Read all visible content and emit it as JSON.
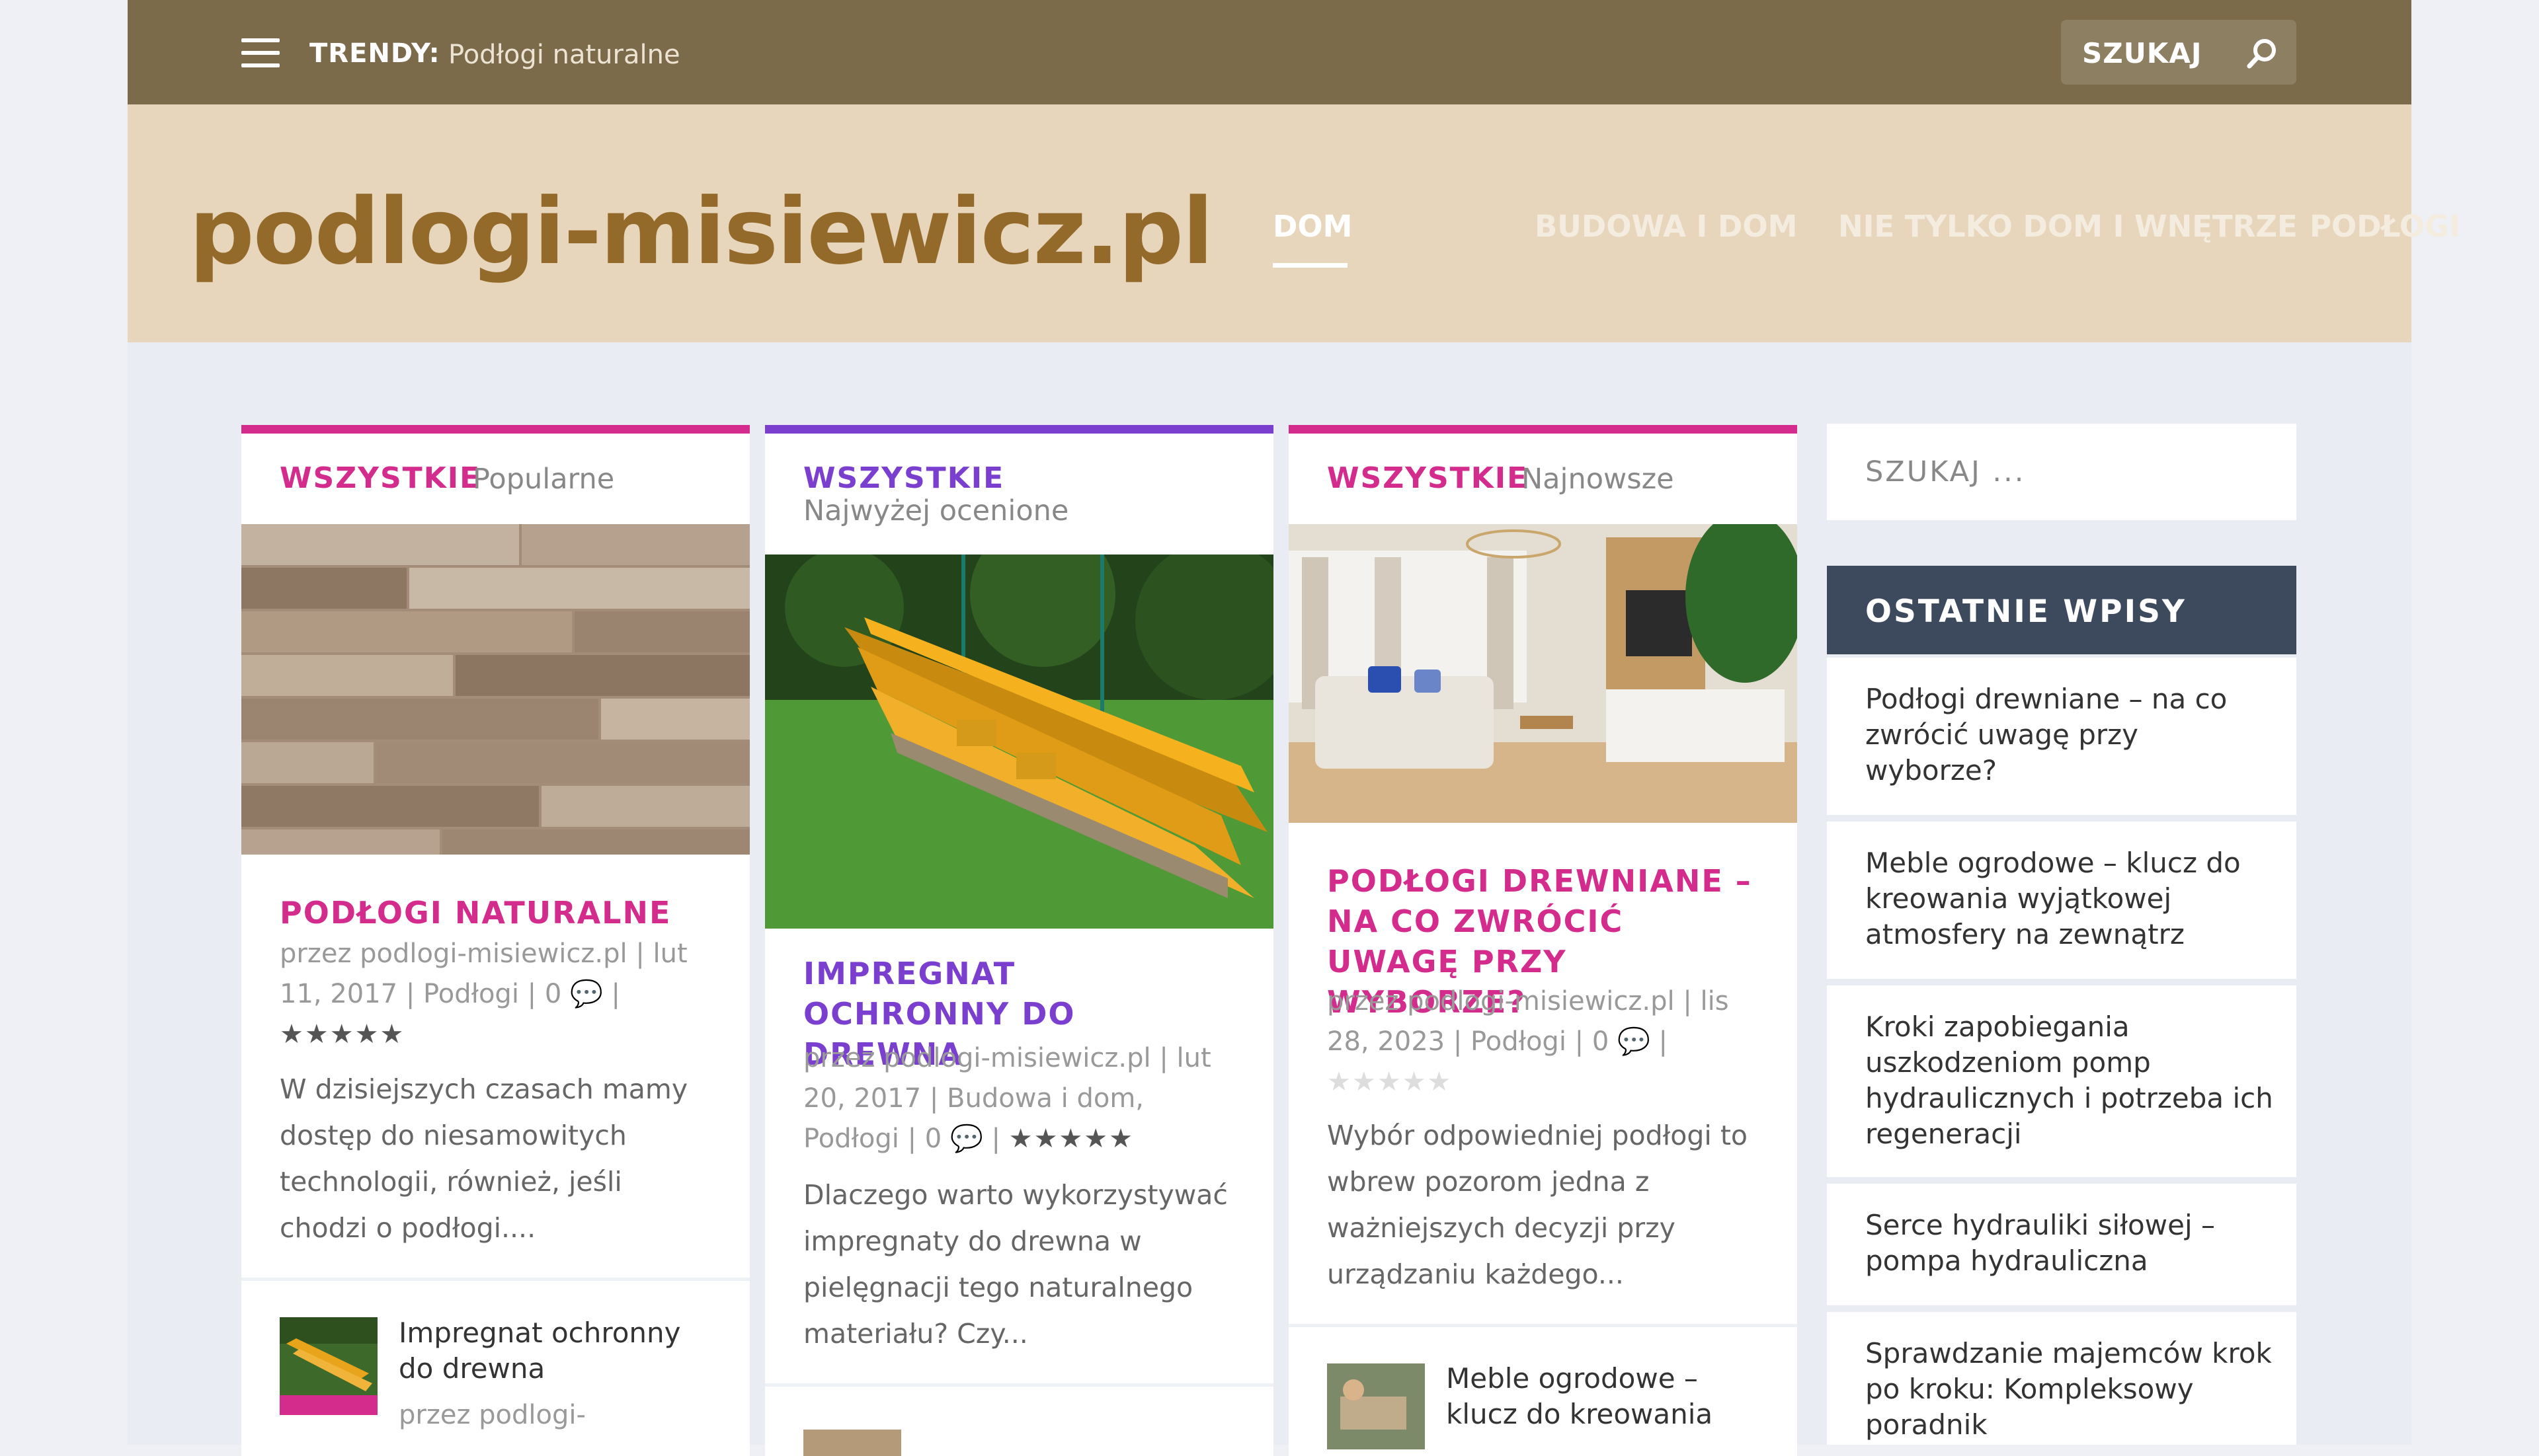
{
  "topbar": {
    "trendy_label": "TRENDY:",
    "trendy_link": "Podłogi naturalne",
    "search_label": "SZUKAJ"
  },
  "header": {
    "logo": "podlogi-misiewicz.pl",
    "nav": [
      "DOM",
      "BUDOWA I DOM",
      "NIE TYLKO DOM I WNĘTRZE",
      "PODŁOGI"
    ]
  },
  "colors": {
    "topbar": "#7b6b4b",
    "header": "#e7d6bc",
    "logo": "#946a2b",
    "pink": "#d42c8c",
    "purple": "#7b3fd0",
    "widget_head": "#3d4a5d"
  },
  "cards": [
    {
      "category": "WSZYSTKIE",
      "subtitle": "Popularne",
      "title": "PODŁOGI NATURALNE",
      "meta": "przez podlogi-misiewicz.pl | lut 11, 2017 | Podłogi | 0",
      "stars": "★★★★★",
      "excerpt": "W dzisiejszych czasach mamy dostęp do niesamowitych technologii, również, jeśli chodzi o podłogi....",
      "mini_title": "Impregnat ochronny do drewna",
      "mini_meta": "przez podlogi-"
    },
    {
      "category": "WSZYSTKIE",
      "subtitle": "Najwyżej ocenione",
      "title": "IMPREGNAT OCHRONNY DO DREWNA",
      "meta": "przez podlogi-misiewicz.pl | lut 20, 2017 | Budowa i dom, Podłogi | 0",
      "stars": "★★★★★",
      "excerpt": "Dlaczego warto wykorzystywać impregnaty do drewna w pielęgnacji tego naturalnego materiału? Czy..."
    },
    {
      "category": "WSZYSTKIE",
      "subtitle": "Najnowsze",
      "title": "PODŁOGI DREWNIANE – NA CO ZWRÓCIĆ UWAGĘ PRZY WYBORZE?",
      "meta": "przez podlogi-misiewicz.pl | lis 28, 2023 | Podłogi | 0",
      "stars": "★★★★★",
      "excerpt": "Wybór odpowiedniej podłogi to wbrew pozorom jedna z ważniejszych decyzji przy urządzaniu każdego...",
      "mini_title": "Meble ogrodowe – klucz do kreowania"
    }
  ],
  "sidebar": {
    "search_placeholder": "SZUKAJ ...",
    "recent_heading": "OSTATNIE WPISY",
    "recent": [
      "Podłogi drewniane – na co zwrócić uwagę przy wyborze?",
      "Meble ogrodowe – klucz do kreowania wyjątkowej atmosfery na zewnątrz",
      "Kroki zapobiegania uszkodzeniom pomp hydraulicznych i potrzeba ich regeneracji",
      "Serce hydrauliki siłowej – pompa hydrauliczna",
      "Sprawdzanie majemców krok po kroku: Kompleksowy poradnik"
    ]
  }
}
